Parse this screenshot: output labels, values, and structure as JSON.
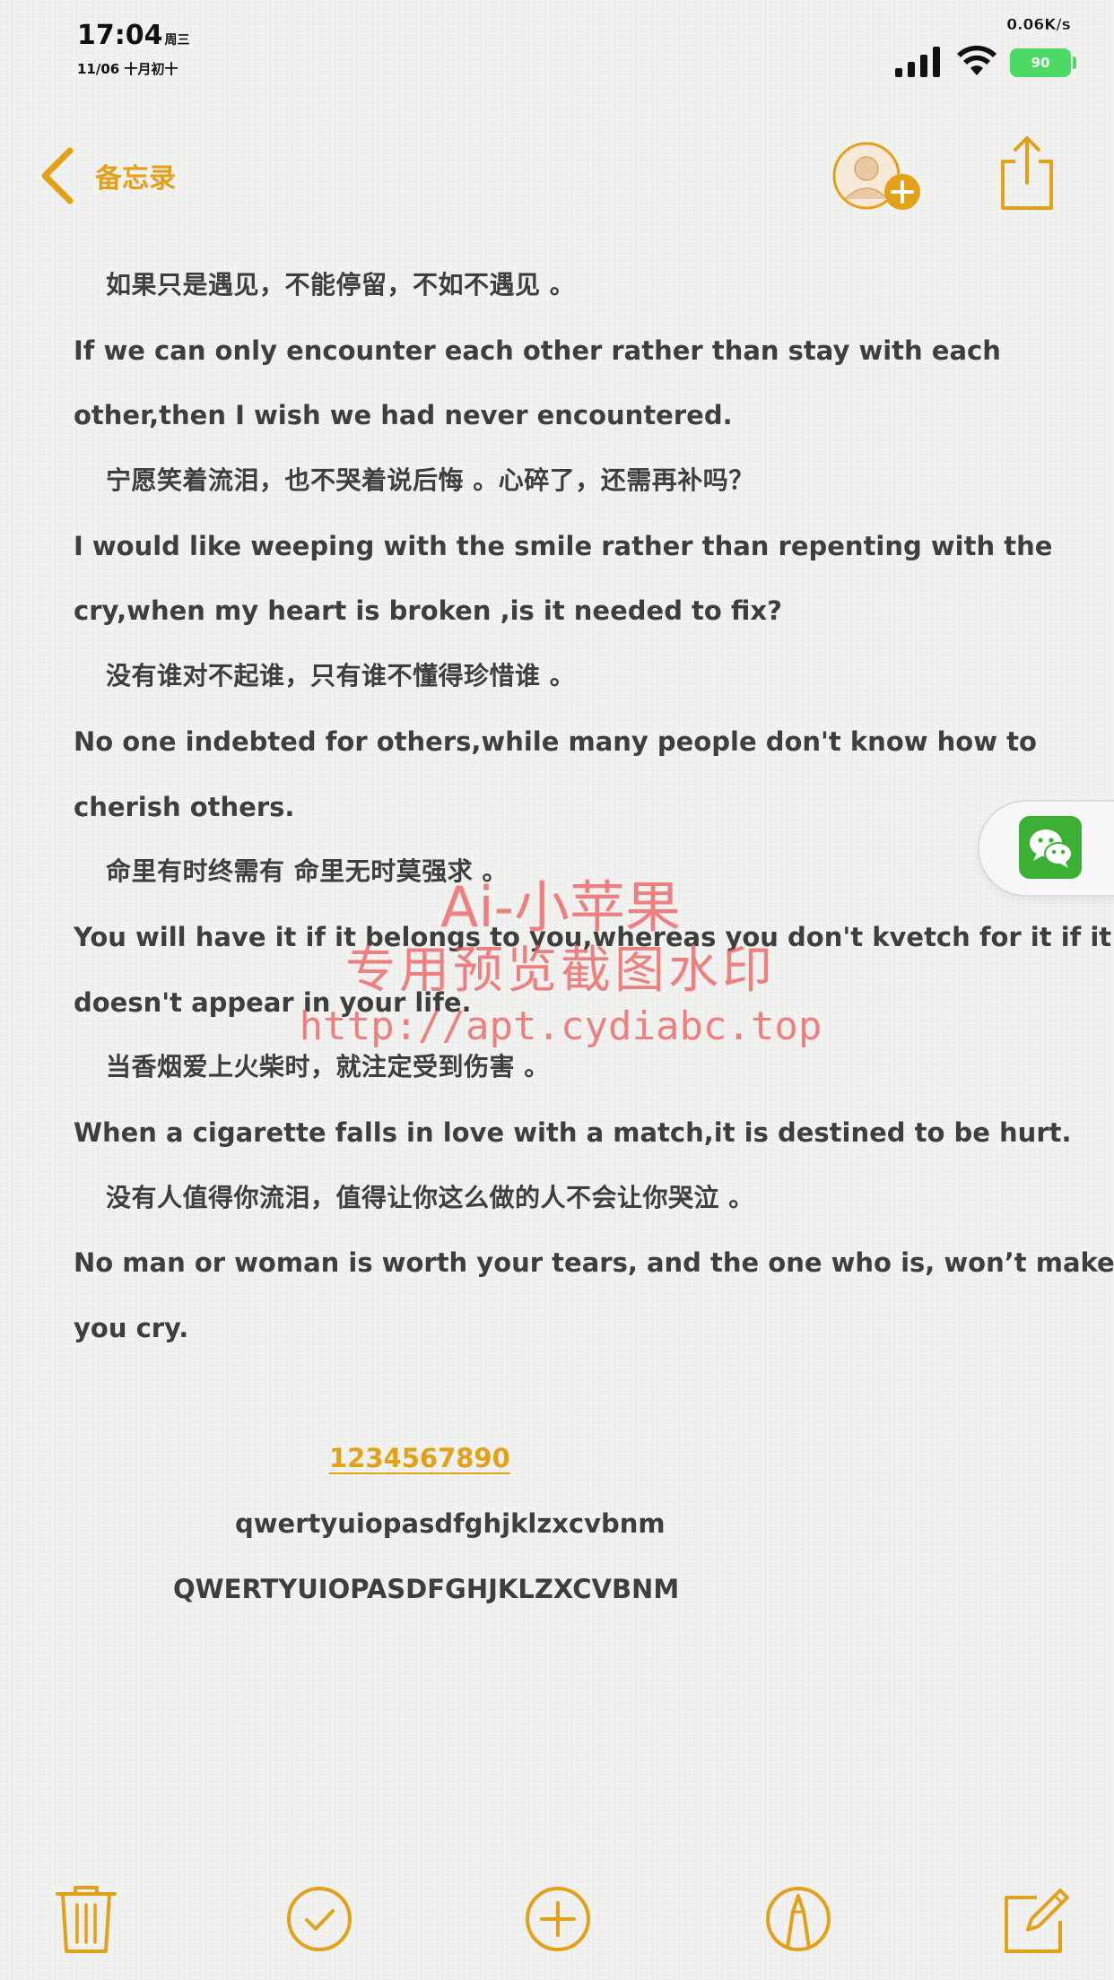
{
  "status_bar": {
    "time": "17:04",
    "weekday": "周三",
    "date": "11/06 十月初十",
    "net_speed": "0.06K/s",
    "battery": "90"
  },
  "nav": {
    "back_label": "备忘录"
  },
  "note": {
    "lines": [
      "如果只是遇见，不能停留，不如不遇见 。",
      "If we can only encounter each other rather than stay with each",
      "other,then I wish we had never encountered.",
      "宁愿笑着流泪，也不哭着说后悔 。心碎了，还需再补吗？",
      "I would like weeping with the smile rather than repenting with the",
      "cry,when my heart is broken ,is it needed to fix?",
      "没有谁对不起谁，只有谁不懂得珍惜谁 。",
      "No one indebted for others,while many people don't know how to",
      "cherish others.",
      "命里有时终需有 命里无时莫强求 。",
      "You will have it if it belongs to you,whereas you don't kvetch for it if it",
      "doesn't appear in your life.",
      "当香烟爱上火柴时，就注定受到伤害 。",
      "When a cigarette falls in love with a match,it is destined to be hurt.",
      "没有人值得你流泪，值得让你这么做的人不会让你哭泣 。",
      "No man or woman is worth your tears, and the one who is, won’t make",
      "you cry."
    ],
    "digits": "1234567890",
    "lowercase": "qwertyuiopasdfghjklzxcvbnm",
    "uppercase": "QWERTYUIOPASDFGHJKLZXCVBNM"
  },
  "watermark": {
    "title": "Ai-小苹果",
    "subtitle": "专用预览截图水印",
    "url": "http://apt.cydiabc.top"
  },
  "icons": {
    "back": "chevron-left-icon",
    "add_people": "add-person-icon",
    "share": "share-icon",
    "wechat": "wechat-icon",
    "trash": "trash-icon",
    "checklist": "checkmark-circle-icon",
    "add": "plus-circle-icon",
    "markup": "pen-circle-icon",
    "compose": "compose-icon"
  },
  "colors": {
    "accent": "#e3a11a",
    "text": "#3e3e3e",
    "background": "#f3f3f1",
    "battery": "#4cd964",
    "watermark": "#ec6060",
    "wechat": "#3cb034"
  }
}
